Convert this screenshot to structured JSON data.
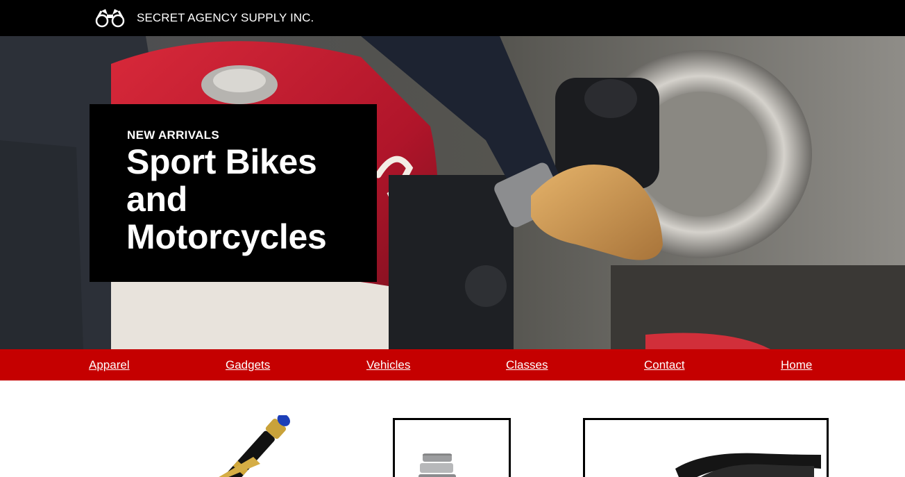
{
  "header": {
    "brand": "SECRET AGENCY SUPPLY INC.",
    "logo_icon": "binoculars-icon"
  },
  "hero": {
    "kicker": "NEW ARRIVALS",
    "title": "Sport Bikes and Motorcycles",
    "image": "motorcycle-rider-photo"
  },
  "nav": {
    "items": [
      {
        "label": "Apparel"
      },
      {
        "label": "Gadgets"
      },
      {
        "label": "Vehicles"
      },
      {
        "label": "Classes"
      },
      {
        "label": "Contact"
      },
      {
        "label": "Home"
      }
    ]
  },
  "products": [
    {
      "image": "fountain-pen-image"
    },
    {
      "image": "wristwatch-image"
    },
    {
      "image": "sunglasses-image"
    }
  ],
  "colors": {
    "header_bg": "#000000",
    "nav_bg": "#c50000",
    "text_light": "#ffffff"
  }
}
